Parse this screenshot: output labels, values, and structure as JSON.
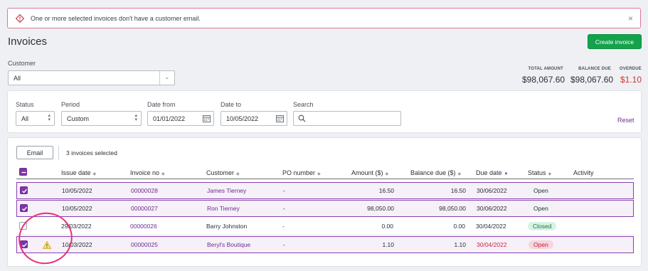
{
  "alert": {
    "message": "One or more selected invoices don't have a customer email.",
    "close": "×"
  },
  "page": {
    "title": "Invoices",
    "create_button": "Create invoice"
  },
  "customer": {
    "label": "Customer",
    "value": "All"
  },
  "totals": [
    {
      "label": "TOTAL AMOUNT",
      "amount": "$98,067.60",
      "overdue": false
    },
    {
      "label": "BALANCE DUE",
      "amount": "$98,067.60",
      "overdue": false
    },
    {
      "label": "OVERDUE",
      "amount": "$1.10",
      "overdue": true
    }
  ],
  "filters": {
    "status": {
      "label": "Status",
      "value": "All"
    },
    "period": {
      "label": "Period",
      "value": "Custom"
    },
    "date_from": {
      "label": "Date from",
      "value": "01/01/2022"
    },
    "date_to": {
      "label": "Date to",
      "value": "10/05/2022"
    },
    "search": {
      "label": "Search",
      "placeholder": ""
    },
    "reset": "Reset"
  },
  "toolbar": {
    "email_button": "Email",
    "selection": "3 invoices selected"
  },
  "columns": {
    "issue_date": "Issue date",
    "invoice_no": "Invoice no",
    "customer": "Customer",
    "po_number": "PO number",
    "amount": "Amount ($)",
    "balance_due": "Balance due ($)",
    "due_date": "Due date",
    "status": "Status",
    "activity": "Activity"
  },
  "rows": [
    {
      "selected": true,
      "issue_date": "10/05/2022",
      "invoice_no": "00000028",
      "customer": "James Tierney",
      "po_number": "-",
      "amount": "16.50",
      "balance_due": "16.50",
      "due_date": "30/06/2022",
      "status": "Open",
      "overdue": false,
      "warning": false
    },
    {
      "selected": true,
      "issue_date": "10/05/2022",
      "invoice_no": "00000027",
      "customer": "Ron Tierney",
      "po_number": "-",
      "amount": "98,050.00",
      "balance_due": "98,050.00",
      "due_date": "30/06/2022",
      "status": "Open",
      "overdue": false,
      "warning": false
    },
    {
      "selected": false,
      "issue_date": "29/03/2022",
      "invoice_no": "00000026",
      "customer": "Barry Johnston",
      "po_number": "-",
      "amount": "0.00",
      "balance_due": "0.00",
      "due_date": "30/04/2022",
      "status": "Closed",
      "overdue": false,
      "warning": false
    },
    {
      "selected": true,
      "issue_date": "10/03/2022",
      "invoice_no": "00000025",
      "customer": "Beryl's Boutique",
      "po_number": "-",
      "amount": "1.10",
      "balance_due": "1.10",
      "due_date": "30/04/2022",
      "status": "Open",
      "overdue": true,
      "warning": true
    }
  ],
  "colors": {
    "accent": "#6d2f8d",
    "create": "#14a34b",
    "overdue": "#d6332b",
    "highlight": "#e7307c"
  },
  "icons": [
    "alert-icon",
    "close-icon",
    "chevron-down-icon",
    "calendar-icon",
    "search-icon",
    "sort-icon",
    "checkbox-icon",
    "warning-icon"
  ]
}
